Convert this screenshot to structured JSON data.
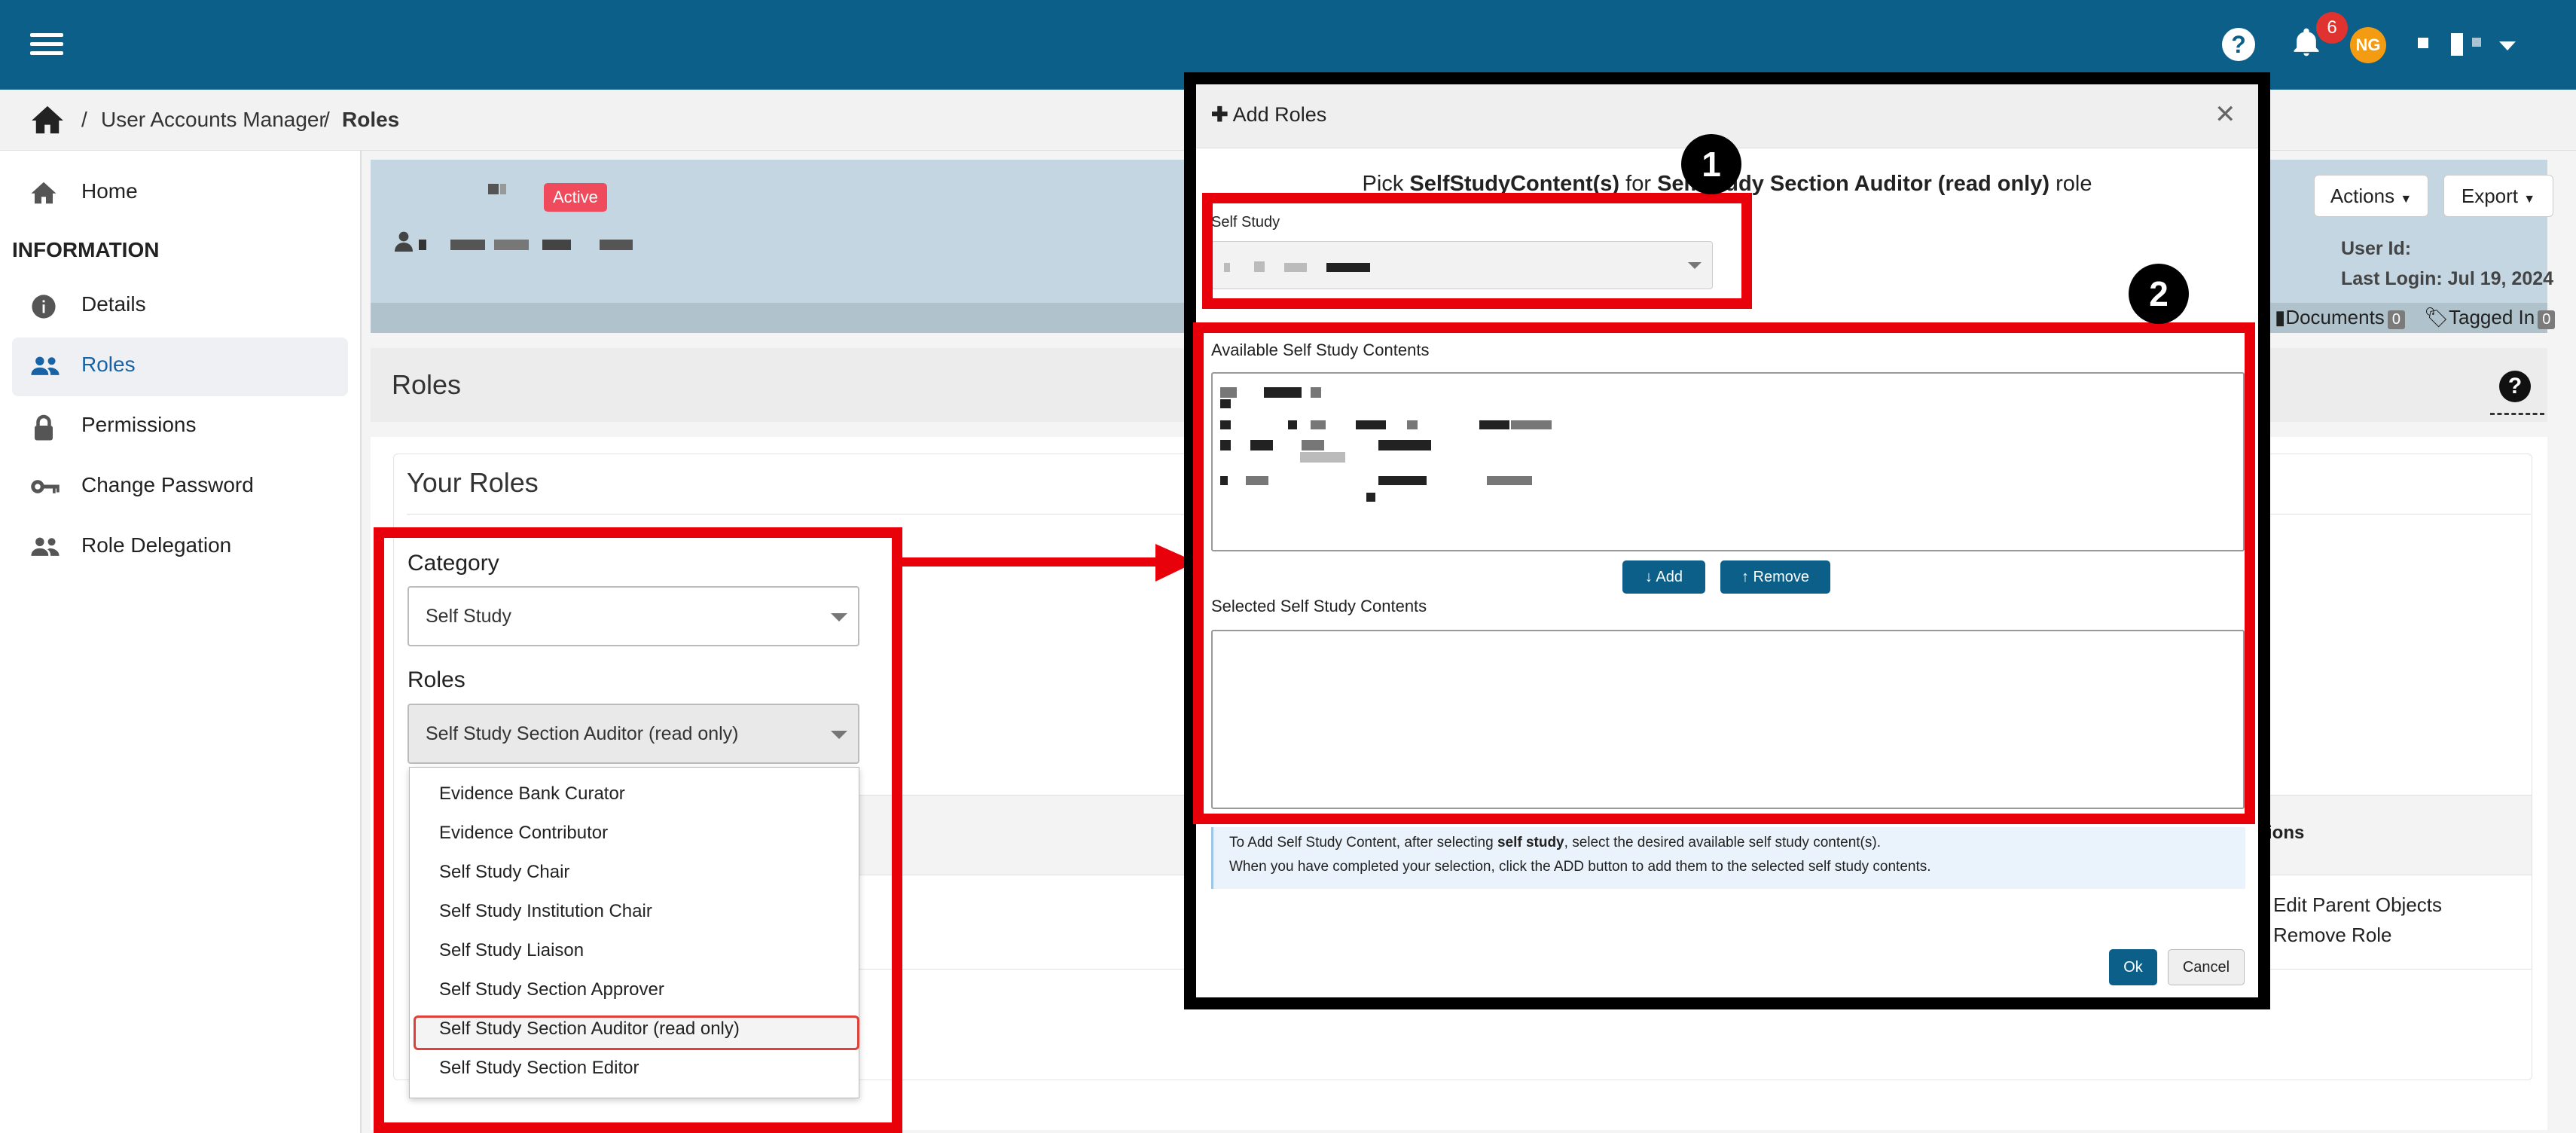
{
  "topbar": {
    "menu_icon": "hamburger-icon",
    "help_icon": "question-circle-icon",
    "notification_icon": "bell-icon",
    "notification_count": "6",
    "avatar_initials": "NG"
  },
  "breadcrumb": {
    "home_icon": "home-icon",
    "items": [
      "User Accounts Manager",
      "Roles"
    ]
  },
  "sidebar": {
    "section_heading": "INFORMATION",
    "items": [
      {
        "label": "Home",
        "icon": "home-icon"
      },
      {
        "label": "Details",
        "icon": "info-circle-icon"
      },
      {
        "label": "Roles",
        "icon": "users-icon"
      },
      {
        "label": "Permissions",
        "icon": "lock-icon"
      },
      {
        "label": "Change Password",
        "icon": "key-icon"
      },
      {
        "label": "Role Delegation",
        "icon": "users-icon"
      }
    ]
  },
  "header": {
    "status_badge": "Active",
    "actions_label": "Actions",
    "export_label": "Export",
    "user_id_label": "User Id:",
    "last_login": "Last Login: Jul 19, 2024",
    "documents_label": "Documents",
    "documents_count": "0",
    "tagged_label": "Tagged In",
    "tagged_count": "0"
  },
  "roles_page": {
    "title": "Roles",
    "your_roles_title": "Your Roles",
    "category_label": "Category",
    "category_value": "Self Study",
    "roles_label": "Roles",
    "roles_value": "Self Study Section Auditor (read only)",
    "role_options": [
      "Evidence Bank Curator",
      "Evidence Contributor",
      "Self Study Chair",
      "Self Study Institution Chair",
      "Self Study Liaison",
      "Self Study Section Approver",
      "Self Study Section Auditor (read only)",
      "Self Study Section Editor"
    ],
    "table_col_actions": "ions",
    "row_action_edit": "Edit Parent Objects",
    "row_action_remove": "Remove Role"
  },
  "modal": {
    "title_icon": "plus-icon",
    "title": "Add Roles",
    "pick_prefix": "Pick ",
    "pick_bold1": "SelfStudyContent(s)",
    "pick_mid": " for ",
    "pick_bold2": "Self Study Section Auditor (read only)",
    "pick_suffix": " role",
    "self_study_label": "Self Study",
    "available_label": "Available Self Study Contents",
    "add_label": "Add",
    "remove_label": "Remove",
    "selected_label": "Selected Self Study Contents",
    "info_line1_a": "To Add Self Study Content, after selecting ",
    "info_line1_b": "self study",
    "info_line1_c": ", select the desired available self study content(s).",
    "info_line2": "When you have completed your selection, click the ADD button to add them to the selected self study contents.",
    "ok_label": "Ok",
    "cancel_label": "Cancel"
  },
  "annotations": {
    "step1": "1",
    "step2": "2"
  },
  "colors": {
    "topbar": "#0b5f89",
    "accent": "#1763a6",
    "annotation_red": "#e8000a",
    "badge_red": "#ef4b5c",
    "avatar_orange": "#f39c12"
  }
}
